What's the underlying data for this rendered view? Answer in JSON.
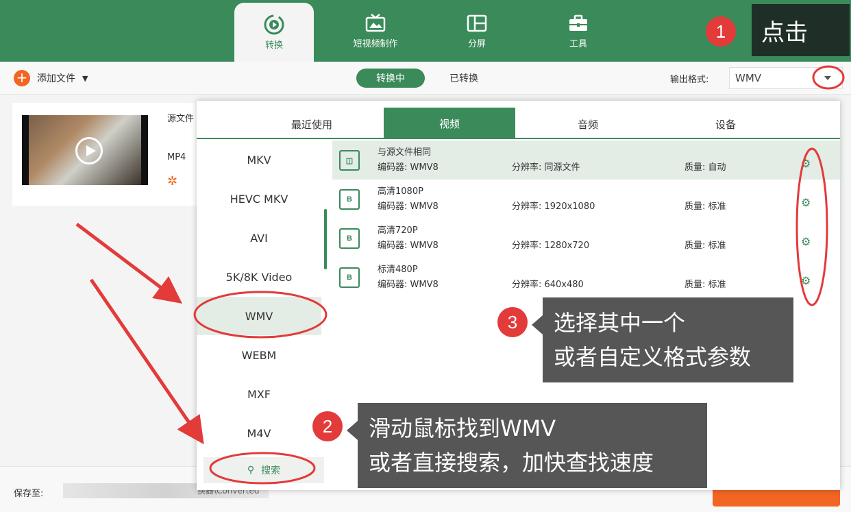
{
  "nav": {
    "tabs": [
      {
        "label": "转换",
        "icon": "convert-icon"
      },
      {
        "label": "短视频制作",
        "icon": "tv-icon"
      },
      {
        "label": "分屏",
        "icon": "split-screen-icon"
      },
      {
        "label": "工具",
        "icon": "toolbox-icon"
      }
    ]
  },
  "toolbar": {
    "add_file": "添加文件",
    "converting": "转换中",
    "converted": "已转换",
    "output_label": "输出格式:",
    "output_value": "WMV"
  },
  "file": {
    "source_label": "源文件",
    "format": "MP4"
  },
  "bottom": {
    "save_label": "保存至:",
    "save_path": "换器\\Converted"
  },
  "panel": {
    "tabs": [
      "最近使用",
      "视频",
      "音频",
      "设备"
    ],
    "formats": [
      "MKV",
      "HEVC MKV",
      "AVI",
      "5K/8K Video",
      "WMV",
      "WEBM",
      "MXF",
      "M4V"
    ],
    "search": "搜索",
    "presets": [
      {
        "name": "与源文件相同",
        "codec": "编码器: WMV8",
        "resolution": "分辨率: 同源文件",
        "quality": "质量: 自动"
      },
      {
        "name": "高清1080P",
        "codec": "编码器: WMV8",
        "resolution": "分辨率: 1920x1080",
        "quality": "质量: 标准"
      },
      {
        "name": "高清720P",
        "codec": "编码器: WMV8",
        "resolution": "分辨率: 1280x720",
        "quality": "质量: 标准"
      },
      {
        "name": "标清480P",
        "codec": "编码器: WMV8",
        "resolution": "分辨率: 640x480",
        "quality": "质量: 标准"
      }
    ]
  },
  "annotations": {
    "step1": {
      "num": "1",
      "text": "点击"
    },
    "step2": {
      "num": "2",
      "line1": "滑动鼠标找到WMV",
      "line2": "或者直接搜索，加快查找速度"
    },
    "step3": {
      "num": "3",
      "line1": "选择其中一个",
      "line2": "或者自定义格式参数"
    }
  },
  "colors": {
    "brand": "#3a8a5a",
    "accent": "#f26522",
    "annotation": "#e33a3a"
  }
}
